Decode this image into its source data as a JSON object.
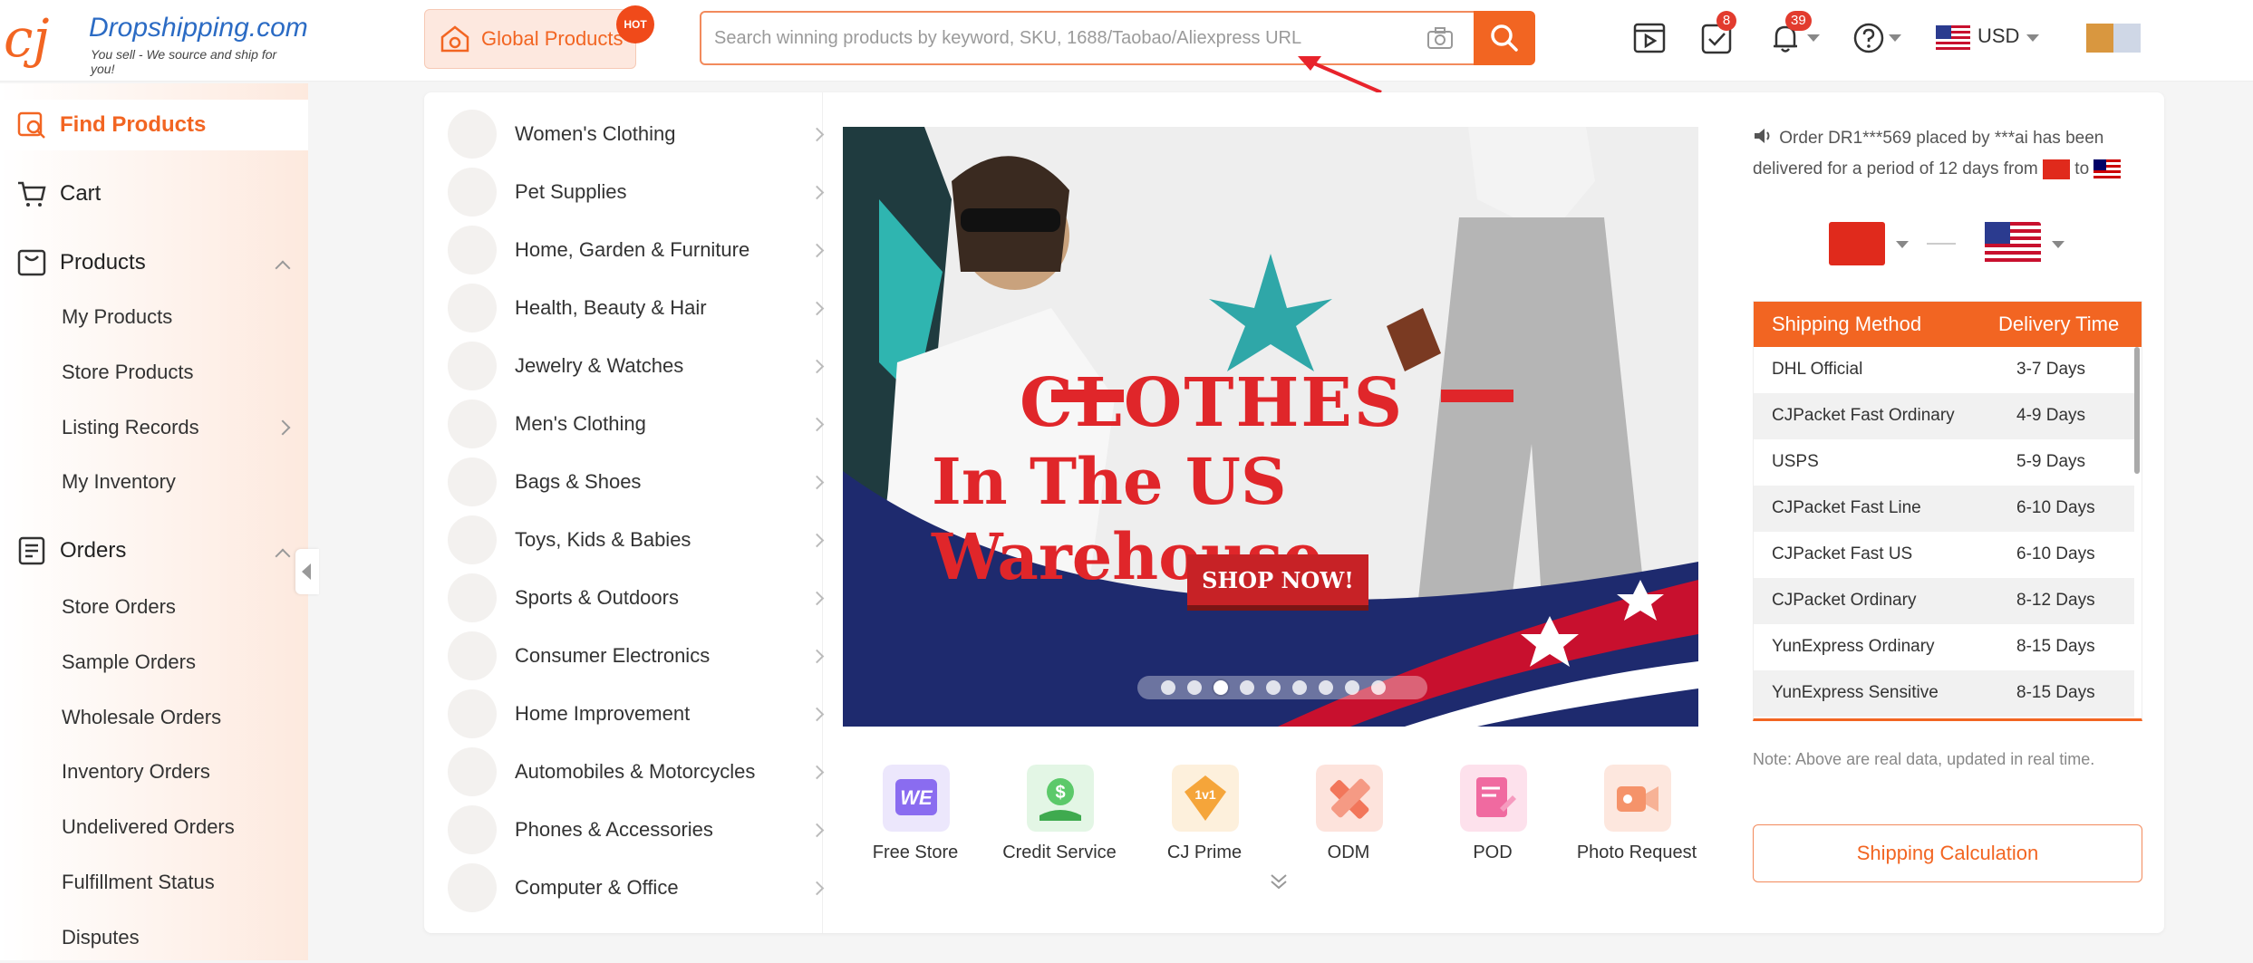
{
  "header": {
    "logo_name": "Dropshipping.com",
    "logo_tagline": "You sell - We source and ship for you!",
    "global_products": "Global Products",
    "hot_badge": "HOT",
    "search_placeholder": "Search winning products by keyword, SKU, 1688/Taobao/Aliexpress URL",
    "orders_badge": "8",
    "notifications_badge": "39",
    "currency": "USD",
    "accent_color": "#f26522"
  },
  "sidebar": {
    "find_products": "Find Products",
    "cart": "Cart",
    "products": "Products",
    "products_sub": [
      "My Products",
      "Store Products",
      "Listing Records",
      "My Inventory"
    ],
    "orders": "Orders",
    "orders_sub": [
      "Store Orders",
      "Sample Orders",
      "Wholesale Orders",
      "Inventory Orders",
      "Undelivered Orders",
      "Fulfillment Status",
      "Disputes"
    ]
  },
  "categories": [
    "Women's Clothing",
    "Pet Supplies",
    "Home, Garden & Furniture",
    "Health, Beauty & Hair",
    "Jewelry & Watches",
    "Men's Clothing",
    "Bags & Shoes",
    "Toys, Kids & Babies",
    "Sports & Outdoors",
    "Consumer Electronics",
    "Home Improvement",
    "Automobiles & Motorcycles",
    "Phones & Accessories",
    "Computer & Office"
  ],
  "banner": {
    "line1": "CLOTHES",
    "line2": "In The US Warehouse",
    "cta": "SHOP NOW!",
    "slide_count": 9,
    "active_slide": 3
  },
  "services": [
    {
      "label": "Free Store",
      "icon": "we-store-icon",
      "color": "#8a6cf0"
    },
    {
      "label": "Credit Service",
      "icon": "dollar-hand-icon",
      "color": "#5cc96a"
    },
    {
      "label": "CJ Prime",
      "icon": "1v1-badge-icon",
      "color": "#f5a53a"
    },
    {
      "label": "ODM",
      "icon": "ruler-icon",
      "color": "#f2765a"
    },
    {
      "label": "POD",
      "icon": "document-edit-icon",
      "color": "#f06aa0"
    },
    {
      "label": "Photo Request",
      "icon": "video-camera-icon",
      "color": "#f5936a"
    }
  ],
  "shipping": {
    "notice_part1": "Order DR1***569 placed by ***ai has been delivered for a period of 12 days from",
    "notice_part2": "to",
    "col_method": "Shipping Method",
    "col_time": "Delivery Time",
    "rows": [
      {
        "method": "DHL Official",
        "time": "3-7 Days"
      },
      {
        "method": "CJPacket Fast Ordinary",
        "time": "4-9 Days"
      },
      {
        "method": "USPS",
        "time": "5-9 Days"
      },
      {
        "method": "CJPacket Fast Line",
        "time": "6-10 Days"
      },
      {
        "method": "CJPacket Fast US",
        "time": "6-10 Days"
      },
      {
        "method": "CJPacket Ordinary",
        "time": "8-12 Days"
      },
      {
        "method": "YunExpress Ordinary",
        "time": "8-15 Days"
      },
      {
        "method": "YunExpress Sensitive",
        "time": "8-15 Days"
      }
    ],
    "note": "Note: Above are real data, updated in real time.",
    "calc_button": "Shipping Calculation"
  }
}
